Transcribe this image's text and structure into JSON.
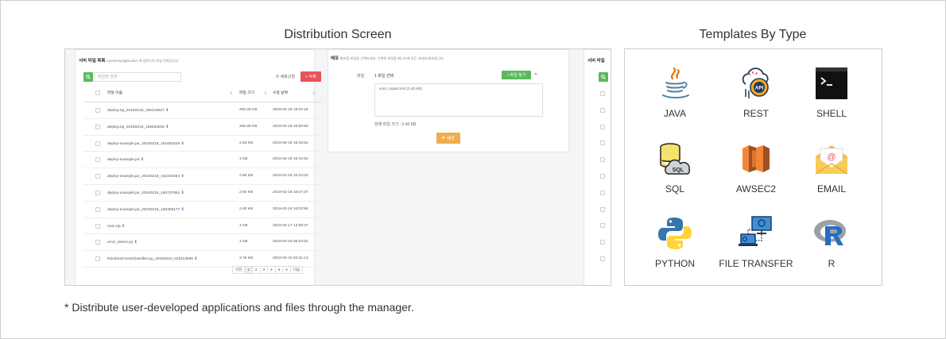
{
  "distribution": {
    "title": "Distribution Screen",
    "left_panel": {
      "title_bold": "서버 파일 목록",
      "title_sub": "repository/application 에 업로드된 파일 목록입니다",
      "search_placeholder": "파일명 검색",
      "refresh_label": "새로고침",
      "delete_label": "삭제",
      "columns": [
        "파일 이름",
        "파일 크기",
        "수정 날짜"
      ],
      "rows": [
        {
          "name": "deploy.zip_20190218_180219527",
          "size": "206.28 KB",
          "date": "2019-02-18 18:02:19"
        },
        {
          "name": "deploy.zip_20190218_165053506",
          "size": "206.25 KB",
          "date": "2019-02-18 16:50:53"
        },
        {
          "name": "deploy-example.jar_20190218_161652526",
          "size": "2.93 KB",
          "date": "2019-02-18 16:16:52"
        },
        {
          "name": "deploy-example.jar",
          "size": "1 KB",
          "date": "2019-02-18 16:16:52"
        },
        {
          "name": "deploy-example.jar_20190218_161003454",
          "size": "2.88 KB",
          "date": "2019-02-18 16:10:03"
        },
        {
          "name": "deploy-example.jar_20190218_160737861",
          "size": "2.93 KB",
          "date": "2019-02-18 16:07:37"
        },
        {
          "name": "deploy-example.jar_20190218_160358177",
          "size": "2.93 KB",
          "date": "2019-02-18 16:03:58"
        },
        {
          "name": "mos.zip",
          "size": "1 KB",
          "date": "2019-02-17 13:59:27"
        },
        {
          "name": "error_detect.py",
          "size": "1 KB",
          "date": "2019-02-16 05:23:52"
        },
        {
          "name": "RandomForestClassifier.py_20190210_023113686",
          "size": "3.76 KB",
          "date": "2019-02-10 02:31:13"
        }
      ],
      "pagination": [
        "이전",
        "1",
        "2",
        "3",
        "4",
        "5",
        "6",
        "다음"
      ]
    },
    "middle_panel": {
      "title_bold": "배포",
      "title_sub": "배포할 파일을 선택하세요. 선택된 파일을 매니저에 모든 서버에 배포합니다",
      "file_label": "파일",
      "selected_count": "1 파일 선택",
      "select_button": "파일 찾기",
      "selected_file": "xmd_copied.xml (2.40 KB)",
      "total": "전체 파일 크기 : 2.40 KB",
      "deploy_button": "배포"
    },
    "right_panel": {
      "title_bold": "서버 파일"
    }
  },
  "templates": {
    "title": "Templates By Type",
    "items": [
      {
        "label": "JAVA",
        "icon": "java-icon"
      },
      {
        "label": "REST",
        "icon": "rest-api-icon"
      },
      {
        "label": "SHELL",
        "icon": "shell-terminal-icon"
      },
      {
        "label": "SQL",
        "icon": "sql-database-icon"
      },
      {
        "label": "AWSEC2",
        "icon": "aws-ec2-icon"
      },
      {
        "label": "EMAIL",
        "icon": "email-envelope-icon"
      },
      {
        "label": "PYTHON",
        "icon": "python-icon"
      },
      {
        "label": "FILE TRANSFER",
        "icon": "file-transfer-icon"
      },
      {
        "label": "R",
        "icon": "r-language-icon"
      }
    ]
  },
  "footnote": "* Distribute user-developed applications and files through the manager.",
  "colors": {
    "green": "#5cb85c",
    "red": "#e9545b",
    "orange": "#f0ad4e",
    "java_red": "#e76f00",
    "java_blue": "#5382a1",
    "aws_orange": "#e8771f",
    "python_blue": "#3776ab",
    "python_yellow": "#ffd43b",
    "r_blue": "#276dc3"
  }
}
